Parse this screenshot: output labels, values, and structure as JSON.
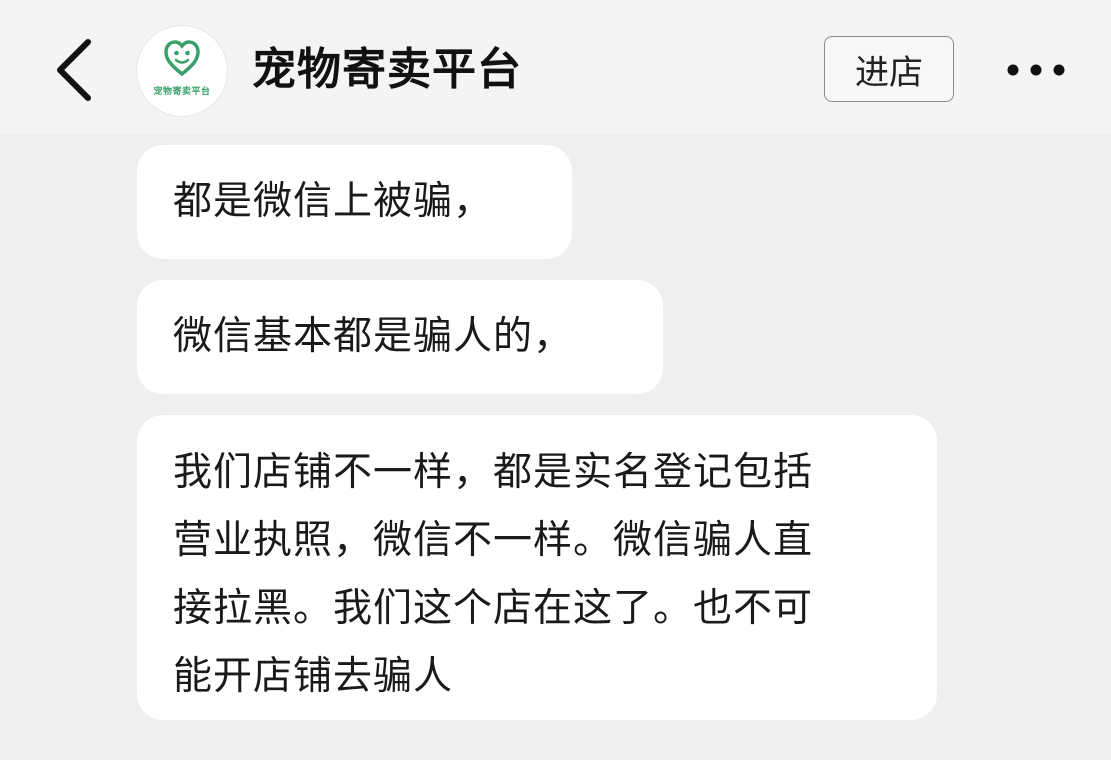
{
  "header": {
    "back_icon": "chevron-left-icon",
    "avatar_text": "宠物寄卖平台",
    "title": "宠物寄卖平台",
    "enter_label": "进店",
    "more_icon": "more-horizontal-icon"
  },
  "messages": [
    {
      "lines": [
        "都是微信上被骗，"
      ]
    },
    {
      "lines": [
        "微信基本都是骗人的，"
      ]
    },
    {
      "lines": [
        "我们店铺不一样，都是实名登记包括",
        "营业执照，微信不一样。微信骗人直",
        "接拉黑。我们这个店在这了。也不可",
        "能开店铺去骗人"
      ]
    }
  ],
  "colors": {
    "background": "#efefef",
    "bubble": "#ffffff",
    "brand": "#3aa06a"
  }
}
